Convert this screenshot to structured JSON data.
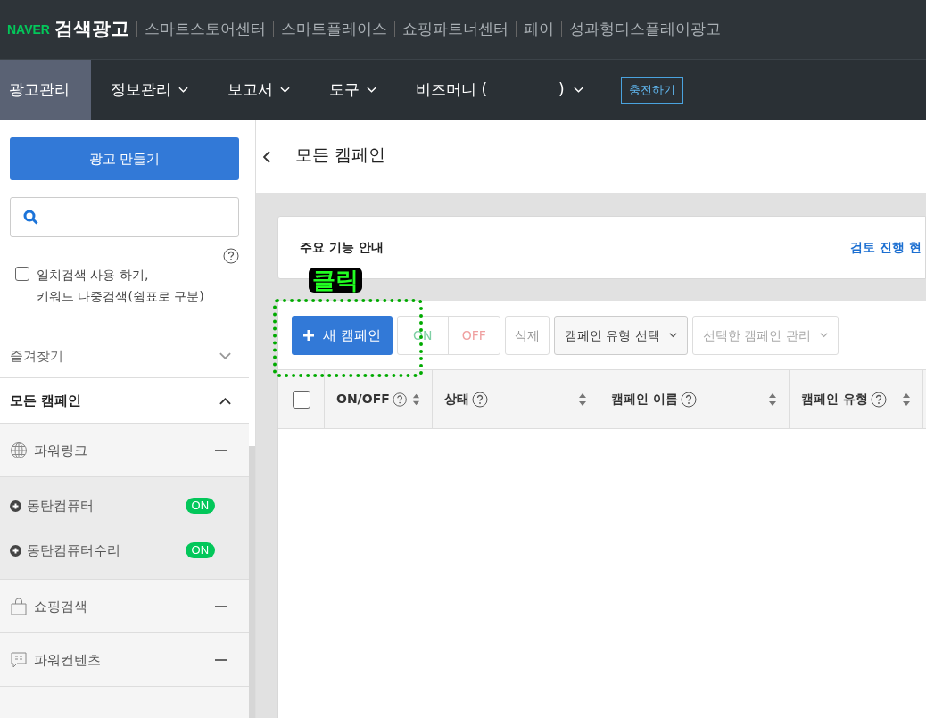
{
  "top_bar": {
    "logo": "NAVER",
    "product": "검색광고",
    "links": [
      "스마트스토어센터",
      "스마트플레이스",
      "쇼핑파트너센터",
      "페이",
      "성과형디스플레이광고"
    ]
  },
  "nav": {
    "items": [
      {
        "label": "광고관리",
        "selected": true,
        "dropdown": false
      },
      {
        "label": "정보관리",
        "selected": false,
        "dropdown": true
      },
      {
        "label": "보고서",
        "selected": false,
        "dropdown": true
      },
      {
        "label": "도구",
        "selected": false,
        "dropdown": true
      }
    ],
    "bizmoney_open": "비즈머니 (",
    "bizmoney_close": ")",
    "charge_button": "충전하기"
  },
  "sidebar": {
    "create_button": "광고 만들기",
    "exact_search": {
      "label": "일치검색 사용 하기,\n키워드 다중검색(쉼표로 구분)",
      "checked": false
    },
    "favorites": {
      "label": "즐겨찾기",
      "expanded": false
    },
    "all_campaigns": {
      "label": "모든 캠페인",
      "expanded": true
    },
    "groups": [
      {
        "kind": "globe",
        "label": "파워링크",
        "expanded": true,
        "children": [
          {
            "label": "동탄컴퓨터",
            "status": "ON"
          },
          {
            "label": "동탄컴퓨터수리",
            "status": "ON"
          }
        ]
      },
      {
        "kind": "bag",
        "label": "쇼핑검색",
        "expanded": true
      },
      {
        "kind": "chat",
        "label": "파워컨텐츠",
        "expanded": true
      }
    ]
  },
  "page_title": "모든 캠페인",
  "guide": {
    "title": "주요 기능 안내",
    "link": "검토 진행 현"
  },
  "annotation": "클릭",
  "toolbar": {
    "new_campaign": "새 캠페인",
    "on": "ON",
    "off": "OFF",
    "delete": "삭제",
    "type_select": "캠페인 유형 선택",
    "manage_select": "선택한 캠페인 관리"
  },
  "table": {
    "select_all_checked": false,
    "columns": [
      "ON/OFF",
      "상태",
      "캠페인 이름",
      "캠페인 유형"
    ]
  }
}
